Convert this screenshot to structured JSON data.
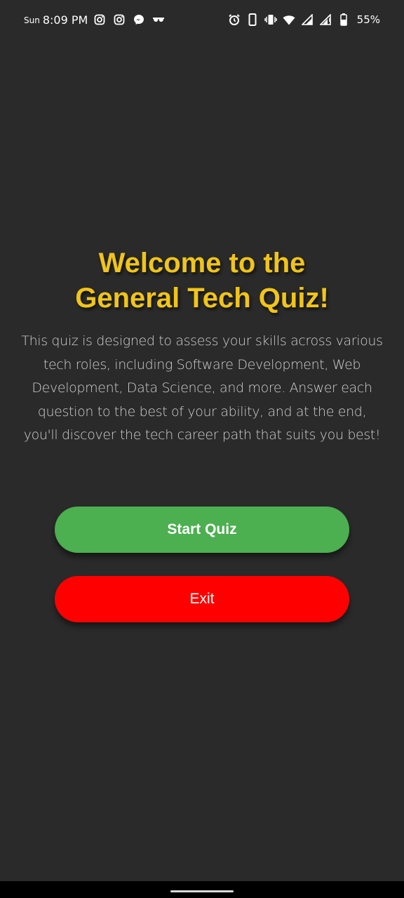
{
  "status_bar": {
    "day": "Sun",
    "time": "8:09 PM",
    "battery": "55%",
    "left_icons": [
      "instagram-icon",
      "instagram-icon",
      "messenger-icon",
      "glasses-icon"
    ],
    "right_icons": [
      "alarm-icon",
      "phone-icon",
      "vibrate-icon",
      "wifi-icon",
      "signal-icon",
      "signal-icon",
      "battery-icon"
    ]
  },
  "welcome": {
    "title_line1": "Welcome to the",
    "title_line2": "General Tech Quiz!",
    "description": "This quiz is designed to assess your skills across various tech roles, including Software Development, Web Development, Data Science, and more. Answer each question to the best of your ability, and at the end, you'll discover the tech career path that suits you best!"
  },
  "buttons": {
    "start_label": "Start Quiz",
    "exit_label": "Exit"
  },
  "colors": {
    "background": "#2a2a2a",
    "title": "#f0c419",
    "start_button": "#4caf50",
    "exit_button": "#ff0000",
    "description": "#cfcfcf"
  }
}
